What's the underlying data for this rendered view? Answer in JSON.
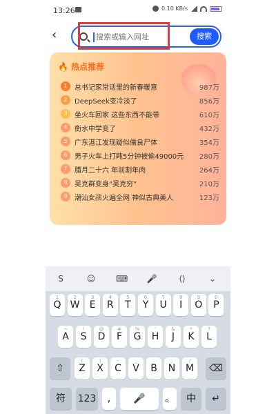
{
  "status": {
    "time": "13:26",
    "net": "0.10 KB/s"
  },
  "search": {
    "placeholder": "搜索或输入网址",
    "button": "搜索"
  },
  "hot": {
    "title": "热点推荐",
    "items": [
      {
        "rank": "1",
        "text": "总书记家常话里的新春暖意",
        "count": "987万"
      },
      {
        "rank": "2",
        "text": "DeepSeek变冷淡了",
        "count": "856万"
      },
      {
        "rank": "3",
        "text": "坐火车回家 这些东西不能带",
        "count": "610万"
      },
      {
        "rank": "4",
        "text": "衡水中学变了",
        "count": "432万"
      },
      {
        "rank": "5",
        "text": "广东湛江发现疑似儒良尸体",
        "count": "354万"
      },
      {
        "rank": "6",
        "text": "男子火车上打盹5分钟被偷49000元",
        "count": "280万"
      },
      {
        "rank": "7",
        "text": "腊月二十六 年前割年肉",
        "count": "264万"
      },
      {
        "rank": "8",
        "text": "吴克群变身“吴克穷”",
        "count": "210万"
      },
      {
        "rank": "9",
        "text": "潮汕女孩火遍全网 神似古典美人",
        "count": "123万"
      }
    ]
  },
  "keyboard": {
    "row1": [
      "Q",
      "W",
      "E",
      "R",
      "T",
      "Y",
      "U",
      "I",
      "O",
      "P"
    ],
    "row1_hint": [
      "1",
      "2",
      "3",
      "4",
      "5",
      "6",
      "7",
      "8",
      "9",
      "0"
    ],
    "row2": [
      "A",
      "S",
      "D",
      "F",
      "G",
      "H",
      "J",
      "K",
      "L"
    ],
    "row2_hint": [
      "~",
      "!",
      "@",
      "#",
      "%",
      "'",
      "&",
      "*",
      "?"
    ],
    "row3": [
      "Z",
      "X",
      "C",
      "V",
      "B",
      "N",
      "M"
    ],
    "row3_hint": [
      "(",
      ")",
      "-",
      "_",
      ":",
      ";",
      "/"
    ],
    "row4": [
      "符",
      "123",
      ",",
      "",
      "。",
      "中"
    ]
  }
}
